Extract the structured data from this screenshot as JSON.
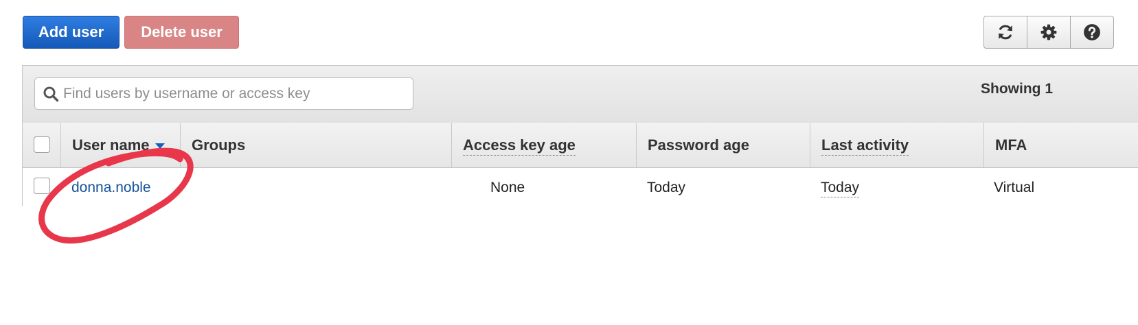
{
  "toolbar": {
    "add_user_label": "Add user",
    "delete_user_label": "Delete user",
    "icons": [
      "refresh-icon",
      "gear-icon",
      "help-icon"
    ]
  },
  "search": {
    "placeholder": "Find users by username or access key",
    "showing_text": "Showing 1"
  },
  "table": {
    "columns": [
      "User name",
      "Groups",
      "Access key age",
      "Password age",
      "Last activity",
      "MFA"
    ],
    "rows": [
      {
        "user_name": "donna.noble",
        "groups": "",
        "access_key_age": "None",
        "password_age": "Today",
        "last_activity": "Today",
        "mfa": "Virtual"
      }
    ]
  },
  "colors": {
    "primary_button": "#1f6fd4",
    "danger_button_disabled": "#d98586",
    "link": "#14539a",
    "annotation": "#e8364a"
  }
}
